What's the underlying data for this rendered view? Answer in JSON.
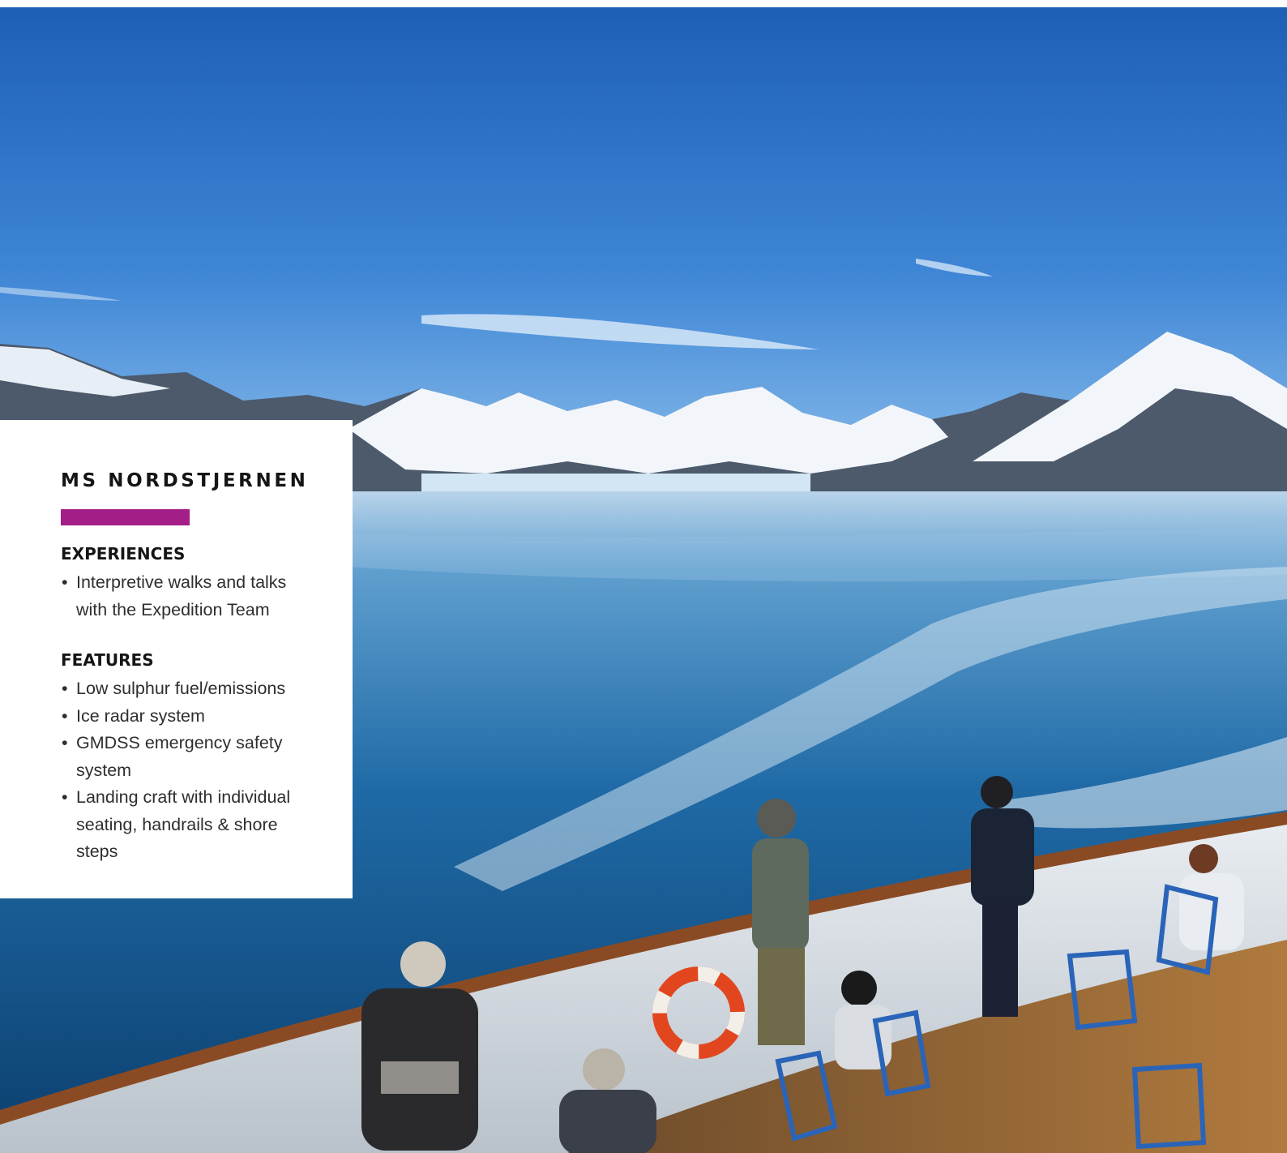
{
  "card": {
    "title": "MS NORDSTJERNEN",
    "accent_color": "#a31e87",
    "sections": [
      {
        "heading": "EXPERIENCES",
        "items": [
          "Interpretive walks and talks with the Expedition Team"
        ]
      },
      {
        "heading": "FEATURES",
        "items": [
          "Low sulphur fuel/emissions",
          "Ice radar system",
          "GMDSS emergency safety system",
          "Landing craft with individual seating, handrails & shore steps"
        ]
      }
    ]
  },
  "photo": {
    "subject": "arctic-fjord-ship-deck-photo",
    "sky_color": "#3f86d6",
    "water_color": "#1f6aa6",
    "snow_color": "#f2f6fb"
  }
}
